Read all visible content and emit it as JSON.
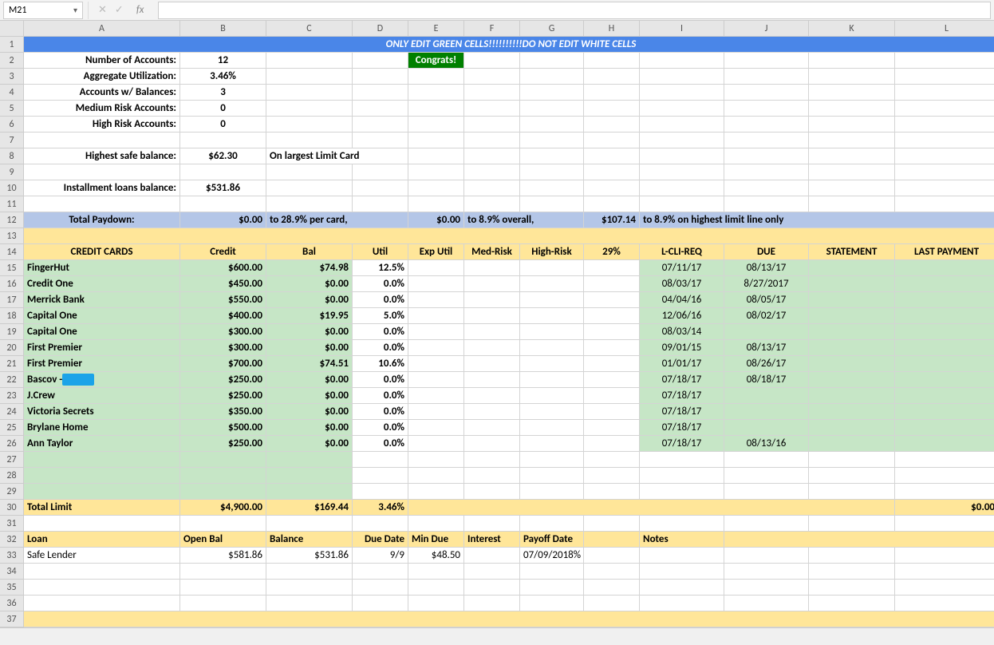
{
  "namebox": "M21",
  "fx_icons": {
    "cancel": "✕",
    "check": "✓",
    "fx": "fx"
  },
  "cols": [
    "A",
    "B",
    "C",
    "D",
    "E",
    "F",
    "G",
    "H",
    "I",
    "J",
    "K",
    "L"
  ],
  "rows": [
    "1",
    "2",
    "3",
    "4",
    "5",
    "6",
    "7",
    "8",
    "9",
    "10",
    "11",
    "12",
    "13",
    "14",
    "15",
    "16",
    "17",
    "18",
    "19",
    "20",
    "21",
    "22",
    "23",
    "24",
    "25",
    "26",
    "27",
    "28",
    "29",
    "30",
    "31",
    "32",
    "33",
    "34",
    "35",
    "36",
    "37"
  ],
  "banner": "ONLY EDIT GREEN CELLS!!!!!!!!!!DO NOT EDIT WHITE CELLS",
  "congrats": "Congrats!",
  "summary": {
    "num_accounts_label": "Number of Accounts:",
    "num_accounts": "12",
    "agg_util_label": "Aggregate Utilization:",
    "agg_util": "3.46%",
    "accts_bal_label": "Accounts w/ Balances:",
    "accts_bal": "3",
    "med_risk_label": "Medium Risk Accounts:",
    "med_risk": "0",
    "high_risk_label": "High Risk Accounts:",
    "high_risk": "0",
    "highest_safe_label": "Highest safe balance:",
    "highest_safe": "$62.30",
    "highest_safe_note": "On largest Limit Card",
    "install_label": "Installment loans balance:",
    "install": "$531.86"
  },
  "paydown": {
    "label": "Total Paydown:",
    "v1": "$0.00",
    "t1": "to 28.9% per card,",
    "v2": "$0.00",
    "t2": "to 8.9% overall,",
    "v3": "$107.14",
    "t3": "to 8.9% on highest limit line only"
  },
  "cc_headers": {
    "name": "CREDIT CARDS",
    "credit": "Credit",
    "bal": "Bal",
    "util": "Util",
    "exputil": "Exp Util",
    "medrisk": "Med-Risk",
    "highrisk": "High-Risk",
    "p29": "29%",
    "lcli": "L-CLI-REQ",
    "due": "DUE",
    "stmt": "STATEMENT",
    "last": "LAST PAYMENT"
  },
  "cards": [
    {
      "name": "FingerHut",
      "credit": "$600.00",
      "bal": "$74.98",
      "util": "12.5%",
      "lcli": "07/11/17",
      "due": "08/13/17"
    },
    {
      "name": "Credit One",
      "credit": "$450.00",
      "bal": "$0.00",
      "util": "0.0%",
      "lcli": "08/03/17",
      "due": "8/27/2017"
    },
    {
      "name": "Merrick Bank",
      "credit": "$550.00",
      "bal": "$0.00",
      "util": "0.0%",
      "lcli": "04/04/16",
      "due": "08/05/17"
    },
    {
      "name": "Capital One",
      "credit": "$400.00",
      "bal": "$19.95",
      "util": "5.0%",
      "lcli": "12/06/16",
      "due": "08/02/17"
    },
    {
      "name": "Capital One",
      "credit": "$300.00",
      "bal": "$0.00",
      "util": "0.0%",
      "lcli": "08/03/14",
      "due": ""
    },
    {
      "name": "First Premier",
      "credit": "$300.00",
      "bal": "$0.00",
      "util": "0.0%",
      "lcli": "09/01/15",
      "due": "08/13/17"
    },
    {
      "name": "First Premier",
      "credit": "$700.00",
      "bal": "$74.51",
      "util": "10.6%",
      "lcli": "01/01/17",
      "due": "08/26/17"
    },
    {
      "name": "Bascov -",
      "credit": "$250.00",
      "bal": "$0.00",
      "util": "0.0%",
      "lcli": "07/18/17",
      "due": "08/18/17",
      "redact": true
    },
    {
      "name": "J.Crew",
      "credit": "$250.00",
      "bal": "$0.00",
      "util": "0.0%",
      "lcli": "07/18/17",
      "due": ""
    },
    {
      "name": "Victoria Secrets",
      "credit": "$350.00",
      "bal": "$0.00",
      "util": "0.0%",
      "lcli": "07/18/17",
      "due": ""
    },
    {
      "name": "Brylane Home",
      "credit": "$500.00",
      "bal": "$0.00",
      "util": "0.0%",
      "lcli": "07/18/17",
      "due": ""
    },
    {
      "name": "Ann Taylor",
      "credit": "$250.00",
      "bal": "$0.00",
      "util": "0.0%",
      "lcli": "07/18/17",
      "due": "08/13/16"
    }
  ],
  "totals": {
    "label": "Total Limit",
    "credit": "$4,900.00",
    "bal": "$169.44",
    "util": "3.46%",
    "last": "$0.00"
  },
  "loan_headers": {
    "loan": "Loan",
    "openbal": "Open Bal",
    "balance": "Balance",
    "duedate": "Due Date",
    "mindue": "Min Due",
    "interest": "Interest",
    "payoff": "Payoff Date",
    "notes": "Notes"
  },
  "loans": [
    {
      "name": "Safe Lender",
      "open": "$581.86",
      "bal": "$531.86",
      "due": "9/9",
      "min": "$48.50",
      "interest": "",
      "payoff": "07/09/2018%",
      "notes": ""
    }
  ]
}
